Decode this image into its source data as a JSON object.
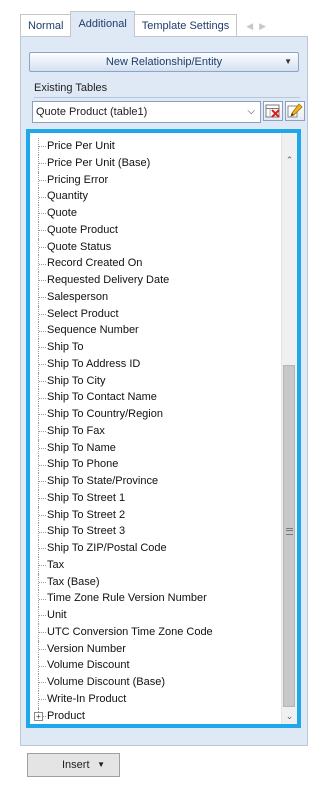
{
  "tabs": [
    "Normal",
    "Additional",
    "Template Settings"
  ],
  "active_tab": "Additional",
  "tab_nav": {
    "prev": "◀",
    "next": "▶"
  },
  "new_relationship_button": "New Relationship/Entity",
  "existing_tables_label": "Existing Tables",
  "existing_tables_value": "Quote Product  (table1)",
  "tree_items": [
    "Price Per Unit",
    "Price Per Unit (Base)",
    "Pricing Error",
    "Quantity",
    "Quote",
    "Quote Product",
    "Quote Status",
    "Record Created On",
    "Requested Delivery Date",
    "Salesperson",
    "Select Product",
    "Sequence Number",
    "Ship To",
    "Ship To Address ID",
    "Ship To City",
    "Ship To Contact Name",
    "Ship To Country/Region",
    "Ship To Fax",
    "Ship To Name",
    "Ship To Phone",
    "Ship To State/Province",
    "Ship To Street 1",
    "Ship To Street 2",
    "Ship To Street 3",
    "Ship To ZIP/Postal Code",
    "Tax",
    "Tax (Base)",
    "Time Zone Rule Version Number",
    "Unit",
    "UTC Conversion Time Zone Code",
    "Version Number",
    "Volume Discount",
    "Volume Discount (Base)",
    "Write-In Product"
  ],
  "tree_expandable_item": "Product",
  "insert_button": "Insert",
  "colors": {
    "accent_border": "#1ea8ea",
    "panel_bg": "#dfe9f5",
    "tab_text": "#1e3d6b"
  },
  "icons": {
    "delete_table": "delete-table-icon",
    "edit_table": "edit-table-icon",
    "dropdown": "chevron-down-icon",
    "expand": "plus-box-icon"
  }
}
